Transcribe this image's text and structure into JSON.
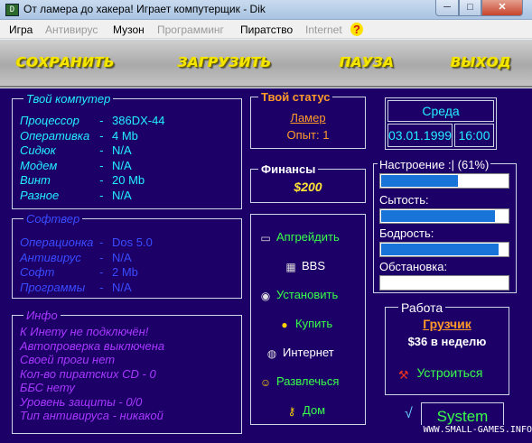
{
  "window": {
    "title": "От ламера до хакера! Играет компутерщик - Dik",
    "min_glyph": "─",
    "max_glyph": "□",
    "close_glyph": "✕",
    "icon_text": "D"
  },
  "menu": {
    "items": [
      {
        "label": "Игра",
        "enabled": true
      },
      {
        "label": "Антивирус",
        "enabled": false
      },
      {
        "label": "Музон",
        "enabled": true
      },
      {
        "label": "Программинг",
        "enabled": false
      },
      {
        "label": "Пиратство",
        "enabled": true
      },
      {
        "label": "Internet",
        "enabled": false
      }
    ],
    "help_glyph": "?"
  },
  "toolbar": {
    "save": "СОХРАНИТЬ",
    "load": "ЗАГРУЗИТЬ",
    "pause": "ПАУЗА",
    "exit": "ВЫХОД"
  },
  "computer": {
    "title": "Твой компутер",
    "rows": [
      {
        "label": "Процессор",
        "sep": "-",
        "value": "386DX-44"
      },
      {
        "label": "Оперативка",
        "sep": "-",
        "value": "4 Mb"
      },
      {
        "label": "Сидюк",
        "sep": "-",
        "value": "N/A"
      },
      {
        "label": "Модем",
        "sep": "-",
        "value": "N/A"
      },
      {
        "label": "Винт",
        "sep": "-",
        "value": "20 Mb"
      },
      {
        "label": "Разное",
        "sep": "-",
        "value": "N/A"
      }
    ]
  },
  "software": {
    "title": "Софтвер",
    "rows": [
      {
        "label": "Операционка",
        "sep": "-",
        "value": "Dos 5.0"
      },
      {
        "label": "Антивирус",
        "sep": "-",
        "value": "N/A"
      },
      {
        "label": "Софт",
        "sep": "-",
        "value": "2 Mb"
      },
      {
        "label": "Программы",
        "sep": "-",
        "value": "N/A"
      }
    ]
  },
  "info": {
    "title": "Инфо",
    "lines": [
      "К Инету не подключён!",
      "Автопроверка выключена",
      "Своей проги нет",
      "Кол-во пиратских CD - 0",
      "ББС нету",
      "Уровень защиты - 0/0",
      "Тип антивируса - никакой"
    ]
  },
  "status": {
    "title": "Твой статус",
    "rank": "Ламер",
    "experience": "Опыт: 1"
  },
  "finance": {
    "title": "Финансы",
    "amount": "$200"
  },
  "date": {
    "weekday": "Среда",
    "date": "03.01.1999",
    "time": "16:00"
  },
  "meters": [
    {
      "label": "Настроение :| (61%)",
      "level": 0.61
    },
    {
      "label": "Сытость:",
      "level": 0.9
    },
    {
      "label": "Бодрость:",
      "level": 0.93
    },
    {
      "label": "Обстановка:",
      "level": 0.0
    }
  ],
  "actions": [
    {
      "name": "upgrade",
      "label": "Апгрейдить",
      "icon": "computer-icon",
      "color": "#38ff48"
    },
    {
      "name": "bbs",
      "label": "BBS",
      "icon": "bbs-icon",
      "color": "#ffffff"
    },
    {
      "name": "install",
      "label": "Установить",
      "icon": "cd-icon",
      "color": "#38ff48"
    },
    {
      "name": "buy",
      "label": "Купить",
      "icon": "coin-icon",
      "color": "#38ff48"
    },
    {
      "name": "internet",
      "label": "Интернет",
      "icon": "globe-icon",
      "color": "#ffffff"
    },
    {
      "name": "fun",
      "label": "Развлечься",
      "icon": "smiley-icon",
      "color": "#38ff48"
    },
    {
      "name": "home",
      "label": "Дом",
      "icon": "key-icon",
      "color": "#38ff48"
    }
  ],
  "work": {
    "title": "Работа",
    "job": "Грузчик",
    "salary": "$36 в неделю",
    "apply": "Устроиться"
  },
  "system": {
    "label": "System"
  },
  "watermark": "WWW.SMALL-GAMES.INFO"
}
